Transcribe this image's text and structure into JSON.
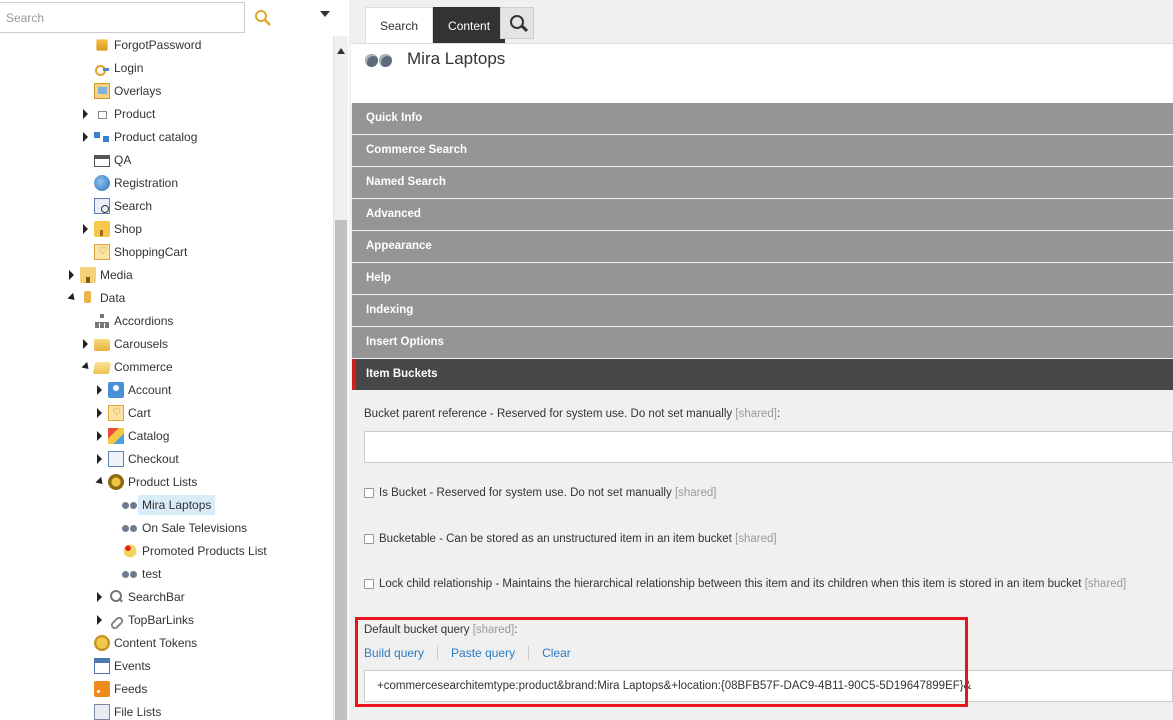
{
  "search": {
    "placeholder": "Search"
  },
  "tree": [
    {
      "label": "ForgotPassword",
      "icon": "key-icon",
      "level": 3,
      "arrow": "none"
    },
    {
      "label": "Login",
      "icon": "login-icon",
      "level": 3,
      "arrow": "none"
    },
    {
      "label": "Overlays",
      "icon": "overlays-icon",
      "level": 3,
      "arrow": "none"
    },
    {
      "label": "Product",
      "icon": "product-icon",
      "level": 3,
      "arrow": "right"
    },
    {
      "label": "Product catalog",
      "icon": "product-catalog-icon",
      "level": 3,
      "arrow": "right"
    },
    {
      "label": "QA",
      "icon": "window-icon",
      "level": 3,
      "arrow": "none"
    },
    {
      "label": "Registration",
      "icon": "registration-icon",
      "level": 3,
      "arrow": "none"
    },
    {
      "label": "Search",
      "icon": "search-page-icon",
      "level": 3,
      "arrow": "none"
    },
    {
      "label": "Shop",
      "icon": "shop-icon",
      "level": 3,
      "arrow": "right"
    },
    {
      "label": "ShoppingCart",
      "icon": "shopping-cart-icon",
      "level": 3,
      "arrow": "none"
    },
    {
      "label": "Media",
      "icon": "media-icon",
      "level": 2,
      "arrow": "right"
    },
    {
      "label": "Data",
      "icon": "data-icon",
      "level": 2,
      "arrow": "down"
    },
    {
      "label": "Accordions",
      "icon": "hierarchy-icon",
      "level": 3,
      "arrow": "none"
    },
    {
      "label": "Carousels",
      "icon": "folder-icon",
      "level": 3,
      "arrow": "right"
    },
    {
      "label": "Commerce",
      "icon": "folder-open-icon",
      "level": 3,
      "arrow": "down"
    },
    {
      "label": "Account",
      "icon": "account-icon",
      "level": 4,
      "arrow": "right"
    },
    {
      "label": "Cart",
      "icon": "cart-icon",
      "level": 4,
      "arrow": "right"
    },
    {
      "label": "Catalog",
      "icon": "catalog-icon",
      "level": 4,
      "arrow": "right"
    },
    {
      "label": "Checkout",
      "icon": "checkout-icon",
      "level": 4,
      "arrow": "right"
    },
    {
      "label": "Product Lists",
      "icon": "product-lists-icon",
      "level": 4,
      "arrow": "down"
    },
    {
      "label": "Mira Laptops",
      "icon": "binoculars-icon",
      "level": 5,
      "arrow": "none",
      "selected": true
    },
    {
      "label": "On Sale Televisions",
      "icon": "binoculars-icon",
      "level": 5,
      "arrow": "none"
    },
    {
      "label": "Promoted Products List",
      "icon": "promoted-icon",
      "level": 5,
      "arrow": "none"
    },
    {
      "label": "test",
      "icon": "binoculars-icon",
      "level": 5,
      "arrow": "none"
    },
    {
      "label": "SearchBar",
      "icon": "magnifier-icon",
      "level": 4,
      "arrow": "right"
    },
    {
      "label": "TopBarLinks",
      "icon": "link-icon",
      "level": 4,
      "arrow": "right"
    },
    {
      "label": "Content Tokens",
      "icon": "tokens-icon",
      "level": 3,
      "arrow": "none"
    },
    {
      "label": "Events",
      "icon": "calendar-icon",
      "level": 3,
      "arrow": "none"
    },
    {
      "label": "Feeds",
      "icon": "rss-icon",
      "level": 3,
      "arrow": "none"
    },
    {
      "label": "File Lists",
      "icon": "file-list-icon",
      "level": 3,
      "arrow": "none"
    }
  ],
  "tabs": {
    "search": "Search",
    "content": "Content"
  },
  "item": {
    "title": "Mira Laptops"
  },
  "sections": [
    "Quick Info",
    "Commerce Search",
    "Named Search",
    "Advanced",
    "Appearance",
    "Help",
    "Indexing",
    "Insert Options",
    "Item Buckets"
  ],
  "fields": {
    "bucket_parent": "Bucket parent reference - Reserved for system use. Do not set manually",
    "is_bucket": "Is Bucket - Reserved for system use. Do not set manually",
    "bucketable": "Bucketable - Can be stored as an unstructured item in an item bucket",
    "lock_child": "Lock child relationship - Maintains the hierarchical relationship between this item and its children when this item is stored in an item bucket",
    "default_query": "Default bucket query",
    "shared": "[shared]",
    "colon": ":"
  },
  "query_actions": {
    "build": "Build query",
    "paste": "Paste query",
    "clear": "Clear"
  },
  "query_value": "+commercesearchitemtype:product&brand:Mira Laptops&+location:{08BFB57F-DAC9-4B11-90C5-5D19647899EF}&",
  "colors": {
    "highlight": "#e8141b",
    "active_section": "#474747",
    "section": "#959595",
    "link": "#2b7bbf"
  }
}
